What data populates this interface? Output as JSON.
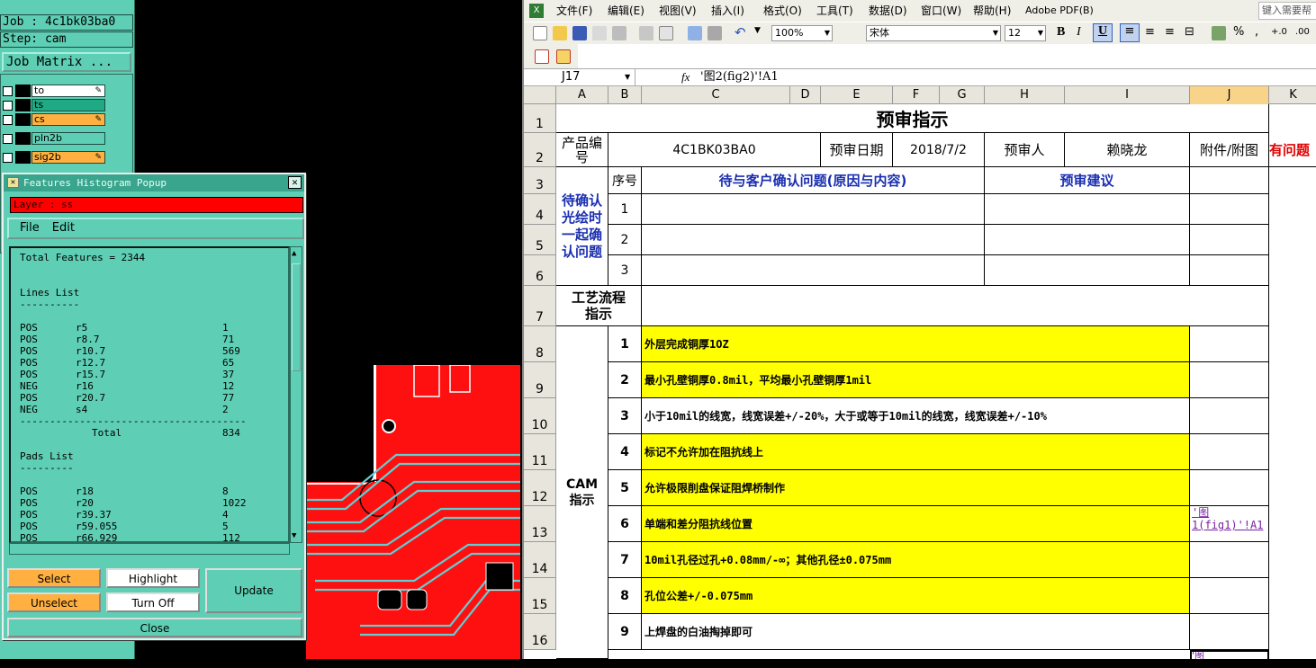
{
  "cam": {
    "job_line": "Job : 4c1bk03ba0",
    "step_line": "Step: cam",
    "job_matrix": "Job Matrix ...",
    "layers": [
      {
        "name": "to",
        "color": "#ffffff"
      },
      {
        "name": "ts",
        "color": "#1fa985"
      },
      {
        "name": "cs",
        "color": "#ffb040"
      },
      {
        "name": "pln2b",
        "color": "#5ecfb4"
      },
      {
        "name": "sig2b",
        "color": "#ffb040"
      }
    ],
    "popup": {
      "title": "Features Histogram Popup",
      "layer_label": "Layer :  ss",
      "menu": [
        "File",
        "Edit"
      ],
      "total_features": "Total Features = 2344",
      "lines_heading": "Lines List",
      "lines": [
        {
          "pol": "POS",
          "sym": "r5",
          "count": "1"
        },
        {
          "pol": "POS",
          "sym": "r8.7",
          "count": "71"
        },
        {
          "pol": "POS",
          "sym": "r10.7",
          "count": "569"
        },
        {
          "pol": "POS",
          "sym": "r12.7",
          "count": "65"
        },
        {
          "pol": "POS",
          "sym": "r15.7",
          "count": "37"
        },
        {
          "pol": "NEG",
          "sym": "r16",
          "count": "12"
        },
        {
          "pol": "POS",
          "sym": "r20.7",
          "count": "77"
        },
        {
          "pol": "NEG",
          "sym": "s4",
          "count": "2"
        }
      ],
      "lines_total_label": "Total",
      "lines_total": "834",
      "pads_heading": "Pads List",
      "pads": [
        {
          "pol": "POS",
          "sym": "r18",
          "count": "8"
        },
        {
          "pol": "POS",
          "sym": "r20",
          "count": "1022"
        },
        {
          "pol": "POS",
          "sym": "r39.37",
          "count": "4"
        },
        {
          "pol": "POS",
          "sym": "r59.055",
          "count": "5"
        },
        {
          "pol": "POS",
          "sym": "r66.929",
          "count": "112"
        }
      ],
      "buttons": {
        "select": "Select",
        "highlight": "Highlight",
        "update": "Update",
        "unselect": "Unselect",
        "turn_off": "Turn Off",
        "close": "Close"
      }
    }
  },
  "excel": {
    "menu": [
      "文件(F)",
      "编辑(E)",
      "视图(V)",
      "插入(I)",
      "格式(O)",
      "工具(T)",
      "数据(D)",
      "窗口(W)",
      "帮助(H)",
      "Adobe PDF(B)"
    ],
    "help_box": "键入需要帮",
    "zoom": "100%",
    "font": "宋体",
    "font_size": "12",
    "name_box": "J17",
    "fx": "fx",
    "formula": "'图2(fig2)'!A1",
    "columns": [
      "A",
      "B",
      "C",
      "D",
      "E",
      "F",
      "G",
      "H",
      "I",
      "J",
      "K"
    ],
    "rows": [
      "1",
      "2",
      "3",
      "4",
      "5",
      "6",
      "7",
      "8",
      "9",
      "10",
      "11",
      "12",
      "13",
      "14",
      "15",
      "16"
    ],
    "title": "预审指示",
    "product_label": "产品编号",
    "product_value": "4C1BK03BA0",
    "date_label": "预审日期",
    "date_value": "2018/7/2",
    "reviewer_label": "预审人",
    "reviewer_value": "赖晓龙",
    "attach_label": "附件/附图",
    "issue_label": "有问题",
    "seq_label": "序号",
    "pending_label": "待与客户确认问题(原因与内容)",
    "advice_label": "预审建议",
    "confirm_group": "待确认光绘时一起确认问题",
    "confirm_seq": [
      "1",
      "2",
      "3"
    ],
    "process_label": "工艺流程指示",
    "cam_label": "CAM指示",
    "cam_items": [
      {
        "n": "1",
        "text": "外层完成铜厚1OZ",
        "yellow": true
      },
      {
        "n": "2",
        "text": "最小孔壁铜厚0.8mil，平均最小孔壁铜厚1mil",
        "yellow": true
      },
      {
        "n": "3",
        "text": "小于10mil的线宽，线宽误差+/-20%，大于或等于10mil的线宽，线宽误差+/-10%",
        "yellow": false
      },
      {
        "n": "4",
        "text": "标记不允许加在阻抗线上",
        "yellow": true
      },
      {
        "n": "5",
        "text": "允许极限削盘保证阻焊桥制作",
        "yellow": true
      },
      {
        "n": "6",
        "text": "单端和差分阻抗线位置",
        "yellow": true
      },
      {
        "n": "7",
        "text": "10mil孔径过孔+0.08mm/-∞；其他孔径±0.075mm",
        "yellow": true
      },
      {
        "n": "8",
        "text": "孔位公差+/-0.075mm",
        "yellow": true
      },
      {
        "n": "9",
        "text": "上焊盘的白油掏掉即可",
        "yellow": false
      }
    ],
    "link_j13": "'图1(fig1)'!A1",
    "link_j17": "'图"
  }
}
